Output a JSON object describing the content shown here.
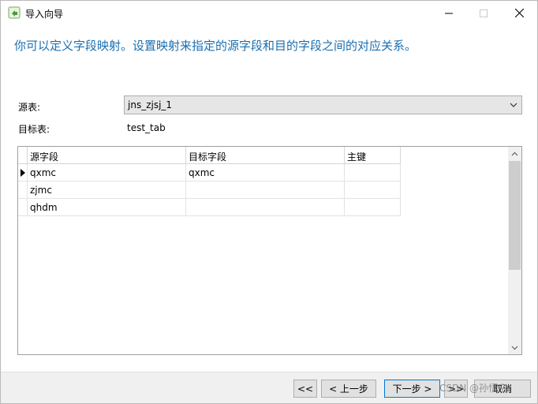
{
  "window": {
    "title": "导入向导",
    "controls": {
      "minimize": "—",
      "maximize": "☐",
      "close": "✕"
    }
  },
  "instruction": "你可以定义字段映射。设置映射来指定的源字段和目的字段之间的对应关系。",
  "form": {
    "source_label": "源表:",
    "source_value": "jns_zjsj_1",
    "target_label": "目标表:",
    "target_value": "test_tab"
  },
  "grid": {
    "columns": [
      "源字段",
      "目标字段",
      "主键"
    ],
    "rows": [
      {
        "source": "qxmc",
        "target": "qxmc",
        "key": "",
        "current": true
      },
      {
        "source": "zjmc",
        "target": "",
        "key": "",
        "current": false
      },
      {
        "source": "qhdm",
        "target": "",
        "key": "",
        "current": false
      }
    ]
  },
  "footer": {
    "first": "<<",
    "prev": "< 上一步",
    "next": "下一步 >",
    "last": ">>",
    "cancel": "取消"
  },
  "watermark": "CSDN @孙悟空",
  "colors": {
    "instruction": "#1a6fb0",
    "focus_border": "#0078d7"
  }
}
